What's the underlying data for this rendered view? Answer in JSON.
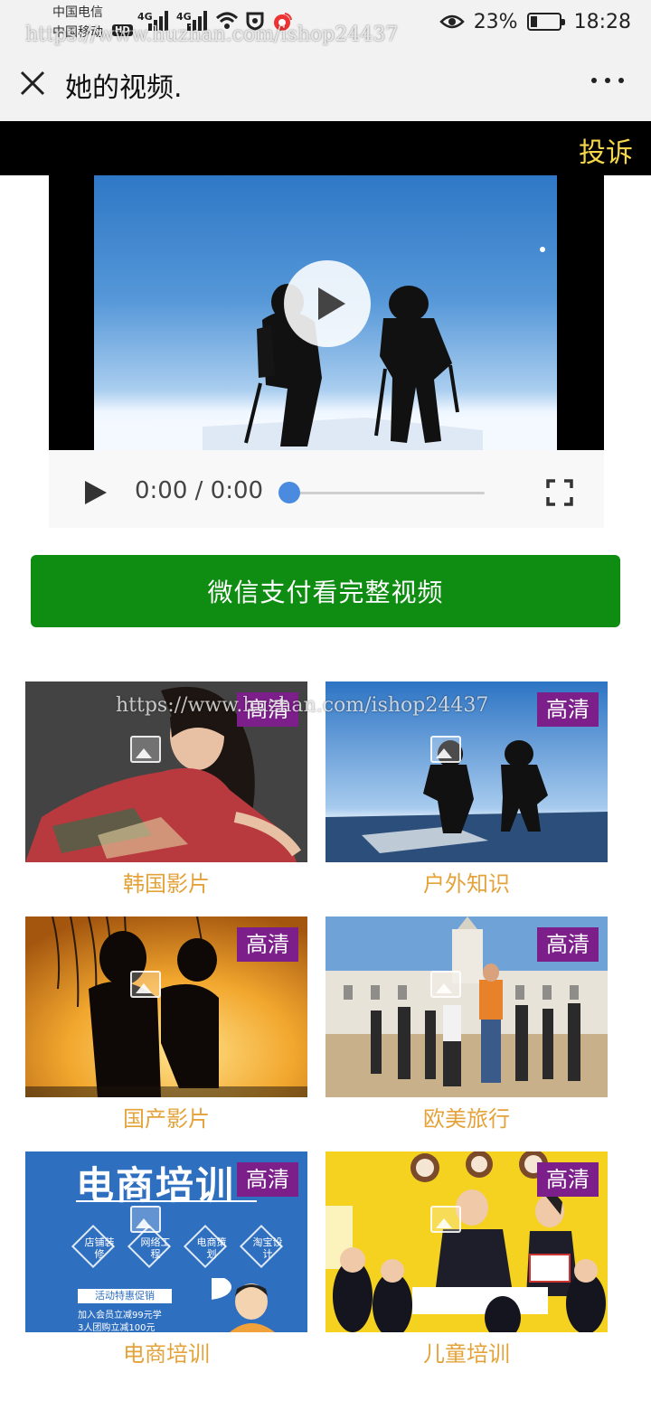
{
  "status_bar": {
    "carrier_1": "中国电信",
    "carrier_2": "中国移动",
    "network_1": "4G",
    "network_2": "4G",
    "hd_badge": "HD",
    "battery_percent": "23%",
    "battery_level": 0.23,
    "time": "18:28"
  },
  "nav": {
    "title": "她的视频."
  },
  "watermark": {
    "text": "https://www.huzhan.com/ishop24437"
  },
  "complaint": {
    "label": "投诉"
  },
  "player": {
    "time_display": "0:00 / 0:00",
    "progress": 0
  },
  "pay_button": {
    "label": "微信支付看完整视频"
  },
  "videos": [
    {
      "title": "韩国影片",
      "badge": "高清"
    },
    {
      "title": "户外知识",
      "badge": "高清"
    },
    {
      "title": "国产影片",
      "badge": "高清"
    },
    {
      "title": "欧美旅行",
      "badge": "高清"
    },
    {
      "title": "电商培训",
      "badge": "高清"
    },
    {
      "title": "儿童培训",
      "badge": "高清"
    }
  ],
  "thumbnail_text": {
    "ecommerce_heading": "电商培训",
    "ecommerce_tags": [
      "店铺装修",
      "网络工程",
      "电商策划",
      "淘宝设计"
    ],
    "ecommerce_promo": "活动特惠促销",
    "ecommerce_line1": "加入会员立减99元学",
    "ecommerce_line2": "3人团购立减100元"
  },
  "colors": {
    "pay_green": "#0f8c12",
    "badge_purple": "#7d1f8a",
    "caption_orange": "#e4a33a",
    "complaint_yellow": "#f6d64a"
  }
}
